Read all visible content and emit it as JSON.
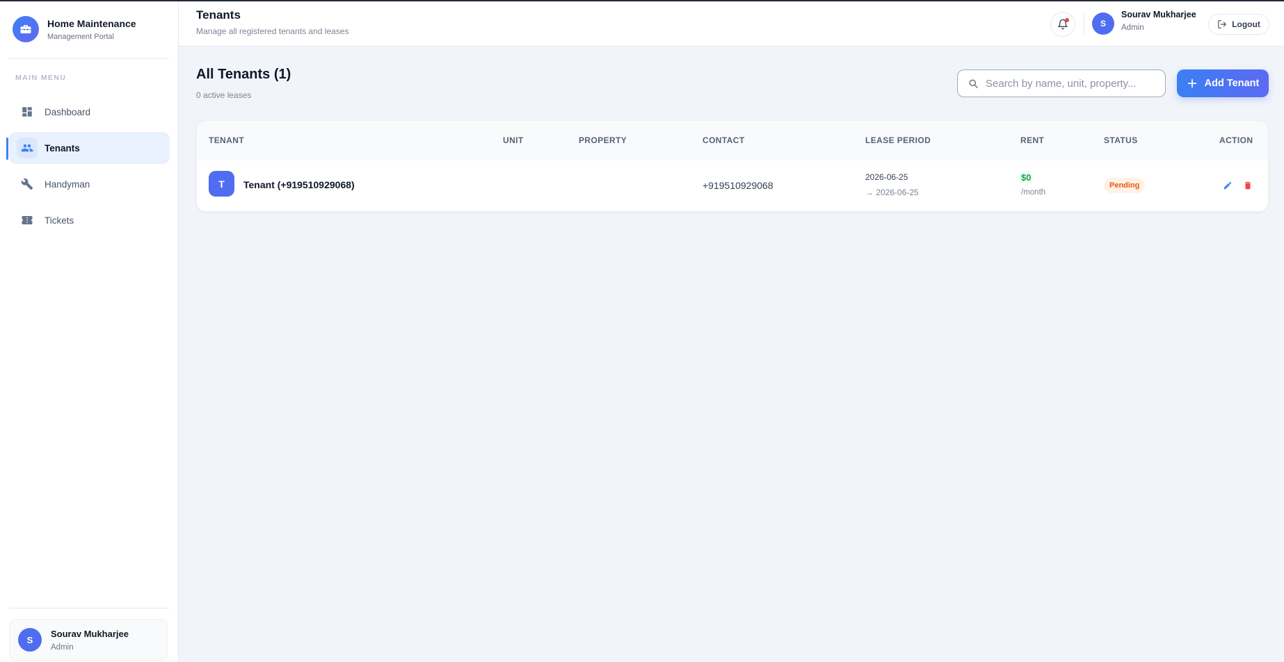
{
  "brand": {
    "title": "Home Maintenance",
    "subtitle": "Management Portal",
    "icon": "toolbox-icon"
  },
  "sidebar": {
    "heading": "MAIN MENU",
    "items": [
      {
        "label": "Dashboard",
        "icon": "dashboard-icon",
        "active": false
      },
      {
        "label": "Tenants",
        "icon": "people-icon",
        "active": true
      },
      {
        "label": "Handyman",
        "icon": "wrench-icon",
        "active": false
      },
      {
        "label": "Tickets",
        "icon": "ticket-icon",
        "active": false
      }
    ],
    "profile": {
      "initial": "S",
      "name": "Sourav Mukharjee",
      "role": "Admin"
    }
  },
  "header": {
    "title": "Tenants",
    "subtitle": "Manage all registered tenants and leases",
    "user": {
      "initial": "S",
      "name": "Sourav Mukharjee",
      "role": "Admin"
    },
    "logout_label": "Logout"
  },
  "main": {
    "heading": "All Tenants (1)",
    "subheading": "0 active leases",
    "search": {
      "placeholder": "Search by name, unit, property...",
      "value": ""
    },
    "add_button_label": "Add Tenant"
  },
  "table": {
    "columns": [
      "TENANT",
      "UNIT",
      "PROPERTY",
      "CONTACT",
      "LEASE PERIOD",
      "RENT",
      "STATUS",
      "ACTION"
    ],
    "rows": [
      {
        "initial": "T",
        "tenant": "Tenant (+919510929068)",
        "unit": "",
        "property": "",
        "contact": "+919510929068",
        "lease_start": "2026-06-25",
        "lease_end": "→ 2026-06-25",
        "rent": "$0",
        "rent_unit": "/month",
        "status": "Pending"
      }
    ]
  },
  "colors": {
    "accent": "#3b82f6",
    "avatar": "#4f6df0",
    "rent_green": "#16a34a",
    "status_pending": "#ea580c",
    "delete_red": "#ef4444",
    "notification_dot": "#ef4444"
  }
}
